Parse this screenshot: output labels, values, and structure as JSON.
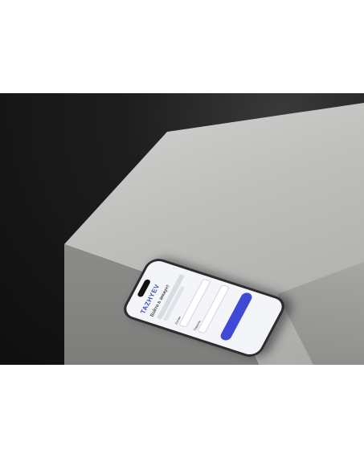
{
  "app": {
    "logo": "TAZHYEV",
    "heading": "Войти в аккаунт",
    "login_label": "Логин",
    "password_label": "Пароль",
    "forgot_label": "",
    "submit_label": "",
    "footer_text": ""
  },
  "colors": {
    "accent": "#3f49d6",
    "background": "#0f0f0f",
    "concrete": "#bfbfbd"
  }
}
